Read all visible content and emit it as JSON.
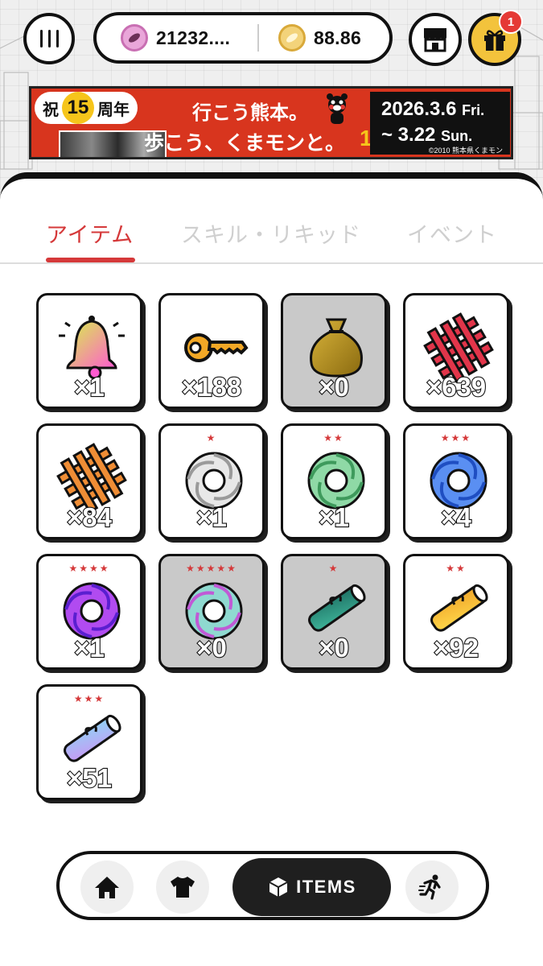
{
  "header": {
    "currency_pink": "21232....",
    "currency_gold": "88.86",
    "gift_badge": "1"
  },
  "banner": {
    "anniversary_prefix": "祝",
    "anniversary_number": "15",
    "anniversary_suffix": "周年",
    "headline_1": "行こう熊本。",
    "headline_2": "歩こう、くまモンと。",
    "date_start": "2026.3.6",
    "date_start_day": "Fri.",
    "date_end": "~ 3.22",
    "date_end_day": "Sun.",
    "copyright": "©2010 熊本県くまモン",
    "logo": "15"
  },
  "tabs": [
    {
      "label": "アイテム",
      "active": true
    },
    {
      "label": "スキル・リキッド",
      "active": false
    },
    {
      "label": "イベント",
      "active": false
    }
  ],
  "items": [
    {
      "icon": "bell-icon",
      "count": "×1",
      "stars": "",
      "owned": true
    },
    {
      "icon": "key-icon",
      "count": "×188",
      "stars": "",
      "owned": true
    },
    {
      "icon": "money-bag-icon",
      "count": "×0",
      "stars": "",
      "owned": false
    },
    {
      "icon": "red-lattice-icon",
      "count": "×639",
      "stars": "",
      "owned": true
    },
    {
      "icon": "orange-lattice-icon",
      "count": "×84",
      "stars": "",
      "owned": true
    },
    {
      "icon": "white-swirl-icon",
      "count": "×1",
      "stars": "★",
      "owned": true
    },
    {
      "icon": "green-swirl-icon",
      "count": "×1",
      "stars": "★★",
      "owned": true
    },
    {
      "icon": "blue-swirl-icon",
      "count": "×4",
      "stars": "★★★",
      "owned": true
    },
    {
      "icon": "purple-swirl-icon",
      "count": "×1",
      "stars": "★★★★",
      "owned": true
    },
    {
      "icon": "rainbow-swirl-icon",
      "count": "×0",
      "stars": "★★★★★",
      "owned": false
    },
    {
      "icon": "teal-scroll-icon",
      "count": "×0",
      "stars": "★",
      "owned": false
    },
    {
      "icon": "yellow-scroll-icon",
      "count": "×92",
      "stars": "★★",
      "owned": true
    },
    {
      "icon": "pastel-scroll-icon",
      "count": "×51",
      "stars": "★★★",
      "owned": true
    }
  ],
  "nav": {
    "items_label": "ITEMS"
  },
  "colors": {
    "accent_red": "#d5393a",
    "gift_yellow": "#f3c33c",
    "banner_red": "#d8351e"
  }
}
